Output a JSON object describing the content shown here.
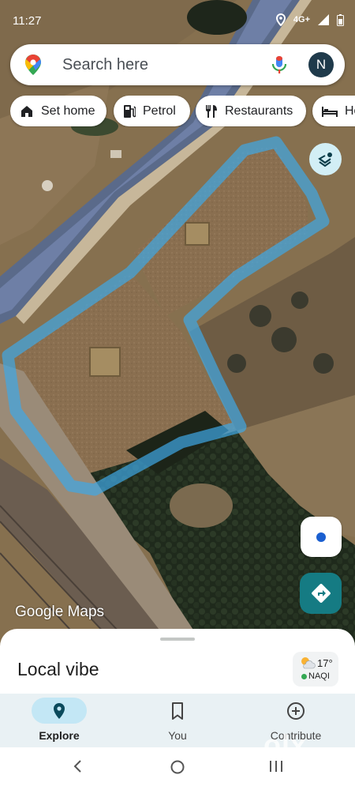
{
  "status_bar": {
    "time": "11:27",
    "network": "4G+"
  },
  "search": {
    "placeholder": "Search here",
    "avatar_initial": "N"
  },
  "chips": [
    {
      "label": "Set home",
      "icon": "home-icon"
    },
    {
      "label": "Petrol",
      "icon": "fuel-pump-icon"
    },
    {
      "label": "Restaurants",
      "icon": "fork-knife-icon"
    },
    {
      "label": "Ho",
      "icon": "bed-icon"
    }
  ],
  "map": {
    "brand": "Google Maps",
    "boundary_color": "#3fa8e6"
  },
  "bottom_sheet": {
    "title": "Local vibe",
    "weather": {
      "temperature": "17°",
      "aqi_label": "NAQI",
      "aqi_color": "#34a853"
    }
  },
  "nav": {
    "items": [
      {
        "label": "Explore",
        "icon": "location-pin-icon",
        "active": true
      },
      {
        "label": "You",
        "icon": "bookmark-icon",
        "active": false
      },
      {
        "label": "Contribute",
        "icon": "add-circle-icon",
        "active": false
      }
    ]
  },
  "watermark": "olx",
  "colors": {
    "accent": "#157b83",
    "nav_active_pill": "#c3e7f5"
  }
}
